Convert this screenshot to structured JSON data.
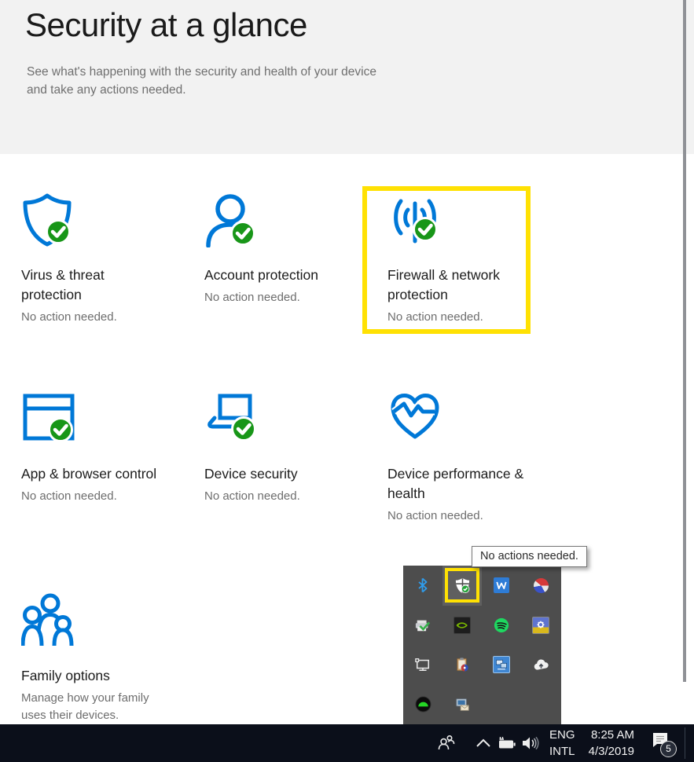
{
  "header": {
    "title": "Security at a glance",
    "subtitle": "See what's happening with the security and health of your device and take any actions needed."
  },
  "tiles": [
    {
      "title": "Virus & threat protection",
      "status": "No action needed.",
      "icon": "shield-check-icon"
    },
    {
      "title": "Account protection",
      "status": "No action needed.",
      "icon": "person-check-icon"
    },
    {
      "title": "Firewall & network protection",
      "status": "No action needed.",
      "icon": "network-signal-check-icon",
      "highlighted": true
    },
    {
      "title": "App & browser control",
      "status": "No action needed.",
      "icon": "app-window-check-icon"
    },
    {
      "title": "Device security",
      "status": "No action needed.",
      "icon": "laptop-check-icon"
    },
    {
      "title": "Device performance & health",
      "status": "No action needed.",
      "icon": "heart-pulse-icon"
    },
    {
      "title": "Family options",
      "status": "Manage how your family uses their devices.",
      "icon": "family-icon"
    }
  ],
  "tooltip": {
    "text": "No actions needed."
  },
  "tray_popup": {
    "icons": [
      "bluetooth-icon",
      "windows-security-shield-icon",
      "w-zigzag-icon",
      "colored-ball-icon",
      "printer-check-icon",
      "nvidia-icon",
      "spotify-icon",
      "gear-app-icon",
      "network-monitor-icon",
      "clipboard-disc-icon",
      "intel-graphics-icon",
      "onedrive-cloud-icon",
      "green-dome-icon",
      "monitor-envelope-icon"
    ],
    "highlighted_icon": "windows-security-shield-icon"
  },
  "taskbar": {
    "language_line1": "ENG",
    "language_line2": "INTL",
    "time": "8:25 AM",
    "date": "4/3/2019",
    "notification_badge": "5",
    "icons": [
      "people-icon",
      "chevron-up-icon",
      "battery-icon",
      "volume-icon",
      "action-center-icon"
    ]
  },
  "colors": {
    "accent_blue": "#0078d7",
    "status_green": "#189618",
    "highlight_yellow": "#ffe103",
    "header_bg": "#f2f2f2",
    "taskbar_bg": "#0b0f1a",
    "tray_bg": "#4d4d4d"
  }
}
